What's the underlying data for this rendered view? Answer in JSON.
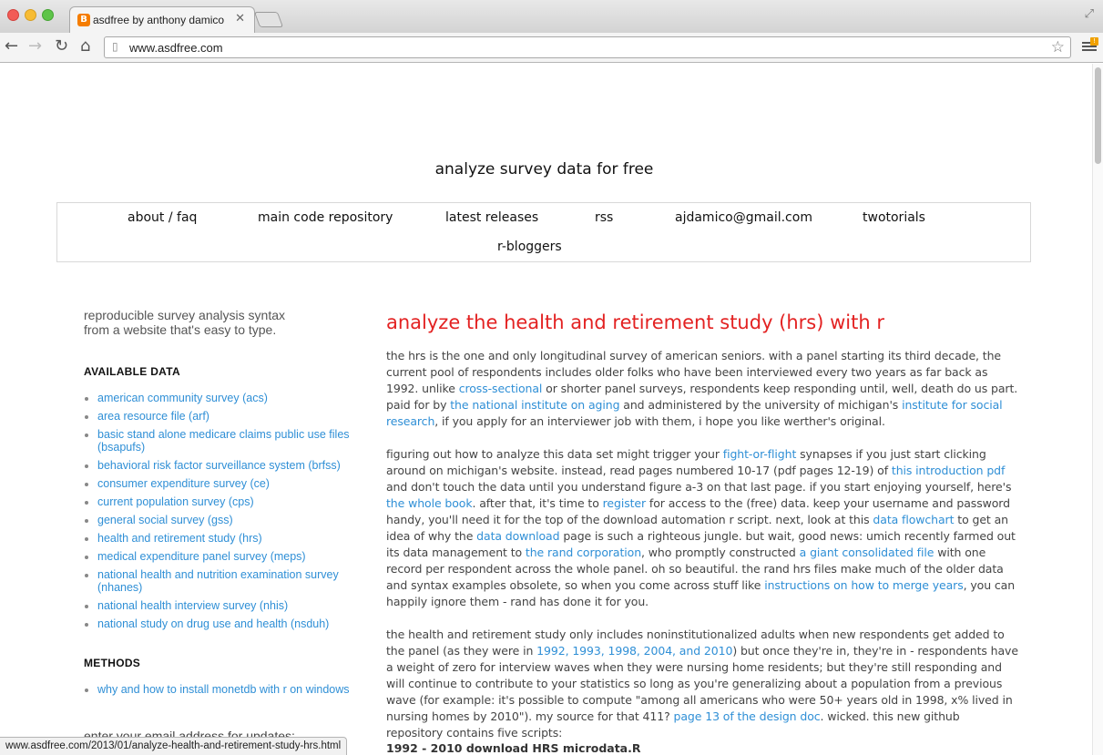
{
  "browser": {
    "tab_title": "asdfree by anthony damico",
    "tab_favicon": "B",
    "url": "www.asdfree.com",
    "status_url": "www.asdfree.com/2013/01/analyze-health-and-retirement-study-hrs.html"
  },
  "site": {
    "title": "analyze survey data for free"
  },
  "nav": {
    "items": [
      "about / faq",
      "main code repository",
      "latest releases",
      "rss",
      "ajdamico@gmail.com",
      "twotorials",
      "r-bloggers"
    ]
  },
  "sidebar": {
    "tagline_line1": "reproducible survey analysis syntax",
    "tagline_line2": "from a website that's easy to type.",
    "available_heading": "AVAILABLE DATA",
    "available": [
      "american community survey (acs)",
      "area resource file (arf)",
      "basic stand alone medicare claims public use files (bsapufs)",
      "behavioral risk factor surveillance system (brfss)",
      "consumer expenditure survey (ce)",
      "current population survey (cps)",
      "general social survey (gss)",
      "health and retirement study (hrs)",
      "medical expenditure panel survey (meps)",
      "national health and nutrition examination survey (nhanes)",
      "national health interview survey (nhis)",
      "national study on drug use and health (nsduh)"
    ],
    "methods_heading": "METHODS",
    "methods": [
      "why and how to install monetdb with r on windows"
    ],
    "email_label": "enter your email address for updates:"
  },
  "post": {
    "title": "analyze the health and retirement study (hrs) with r",
    "p1": {
      "t1": "the hrs is the one and only longitudinal survey of american seniors.  with a panel starting its third decade, the current pool of respondents includes older folks who have been interviewed every two years as far back as 1992.  unlike ",
      "l1": "cross-sectional",
      "t2": " or shorter panel surveys, respondents keep responding until, well, death do us part.  paid for by ",
      "l2": "the national institute on aging",
      "t3": " and administered by the university of michigan's ",
      "l3": "institute for social research",
      "t4": ", if you apply for an interviewer job with them, i hope you like werther's original."
    },
    "p2": {
      "t1": "figuring out how to analyze this data set might trigger your ",
      "l1": "fight-or-flight",
      "t2": " synapses if you just start clicking around on michigan's website.  instead, read pages numbered 10-17 (pdf pages 12-19) of ",
      "l2": "this introduction pdf",
      "t3": " and don't touch the data until you understand figure a-3 on that last page.  if you start enjoying yourself, here's ",
      "l3": "the whole book",
      "t4": ".  after that, it's time to ",
      "l4": "register",
      "t5": " for access to the (free) data.  keep your username and password handy, you'll need it for the top of the download automation r script.  next, look at this ",
      "l5": "data flowchart",
      "t6": " to get an idea of why the ",
      "l6": "data download",
      "t7": " page is such a righteous jungle.  but wait, good news: umich recently farmed out its data management to ",
      "l7": "the rand corporation",
      "t8": ", who promptly constructed ",
      "l8": "a giant consolidated file",
      "t9": " with one record per respondent across the whole panel.  oh so beautiful.  the rand hrs files make much of the older data and syntax examples obsolete, so when you come across stuff like ",
      "l9": "instructions on how to merge years",
      "t10": ", you can happily ignore them - rand has done it for you."
    },
    "p3": {
      "t1": "the health and retirement study only includes noninstitutionalized adults when new respondents get added to the panel (as they were in ",
      "l1": "1992, 1993, 1998, 2004, and 2010",
      "t2": ") but once they're in, they're in - respondents have a weight of zero for interview waves when they were nursing home residents; but they're still responding and will continue to contribute to your statistics so long as you're generalizing about a population from a previous wave (for example: it's possible to compute \"among all americans who were 50+ years old in 1998, x% lived in nursing homes by 2010\").  my source for that 411? ",
      "l2": "page 13 of the design doc",
      "t3": ".  wicked.  this new github repository contains five scripts:"
    },
    "script_heading": "1992 - 2010 download HRS microdata.R"
  }
}
